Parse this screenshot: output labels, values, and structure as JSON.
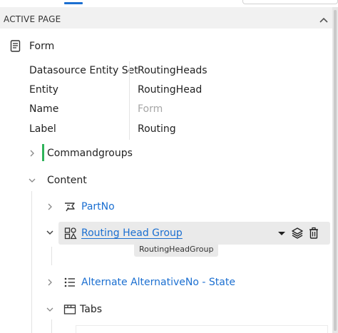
{
  "header": {
    "title": "ACTIVE PAGE"
  },
  "form": {
    "label": "Form",
    "properties": [
      {
        "key": "Datasource Entity Set",
        "value": "RoutingHeads",
        "placeholder": false
      },
      {
        "key": "Entity",
        "value": "RoutingHead",
        "placeholder": false
      },
      {
        "key": "Name",
        "value": "Form",
        "placeholder": true
      },
      {
        "key": "Label",
        "value": "Routing",
        "placeholder": false
      }
    ]
  },
  "tree": {
    "commandgroups": {
      "label": "Commandgroups",
      "expanded": false
    },
    "content": {
      "label": "Content",
      "expanded": true
    },
    "part_no": {
      "label": "PartNo",
      "icon": "field-icon",
      "expanded": false
    },
    "routing_head_group": {
      "label": "Routing Head Group",
      "icon": "group-icon",
      "expanded": true,
      "tooltip": "RoutingHeadGroup"
    },
    "alternate": {
      "label": "Alternate AlternativeNo - State",
      "icon": "list-icon",
      "expanded": false
    },
    "tabs": {
      "label": "Tabs",
      "icon": "tabs-icon",
      "expanded": true
    }
  },
  "colors": {
    "accent": "#1b6fd1",
    "green_marker": "#2fb35a",
    "selected_bg": "#eaeaea"
  }
}
